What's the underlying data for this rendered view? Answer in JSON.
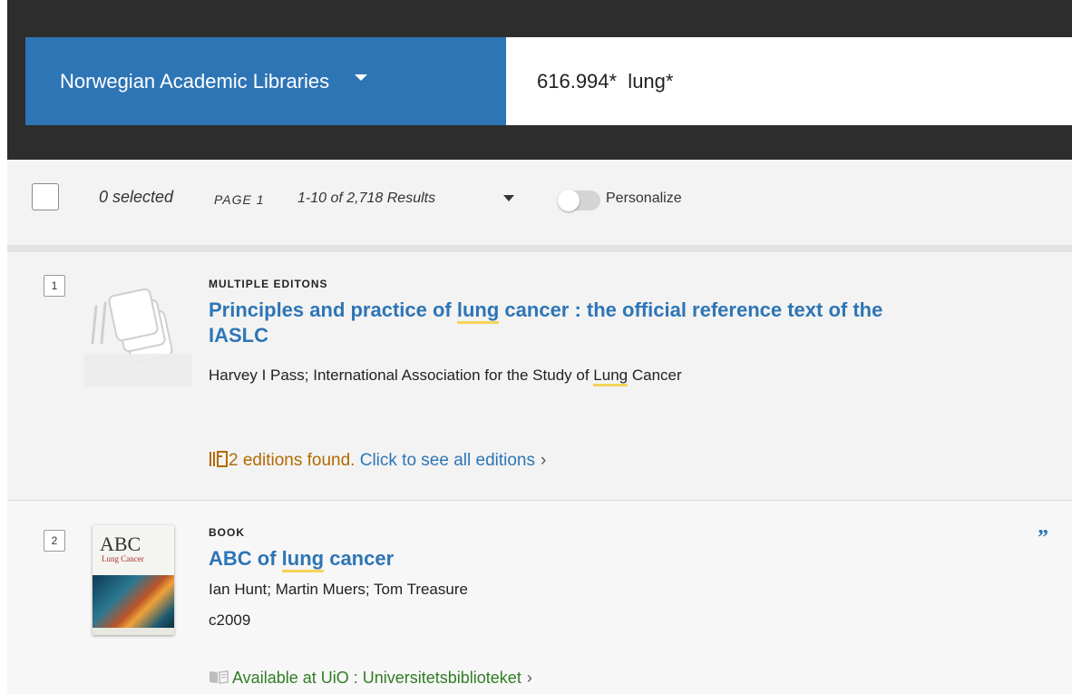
{
  "header": {
    "scope_label": "Norwegian Academic Libraries",
    "query": "616.994*  lung*"
  },
  "toolbar": {
    "selected": "0 selected",
    "page": "PAGE 1",
    "results": "1-10 of 2,718 Results",
    "personalize": "Personalize",
    "personalize_on": false
  },
  "results": [
    {
      "number": "1",
      "type": "MULTIPLE EDITONS",
      "title_before": "Principles and practice of ",
      "title_highlight": "lung",
      "title_after_line1": " cancer : the official reference text of the",
      "title_line2": "IASLC",
      "author_before": "Harvey I Pass; International Association for the Study of ",
      "author_highlight": "Lung",
      "author_after": " Cancer",
      "editions_icon": "editions-icon",
      "editions_found": "2 editions found.",
      "editions_link": "Click to see all editions",
      "thumbnail_icon": "multiple-editions-icon"
    },
    {
      "number": "2",
      "type": "BOOK",
      "title_before": "ABC of ",
      "title_highlight": "lung",
      "title_after": " cancer",
      "authors": "Ian Hunt; Martin Muers; Tom Treasure",
      "date": "c2009",
      "availability_icon": "book-open-icon",
      "availability": "Available at UiO : Universitetsbiblioteket",
      "thumb_title": "ABC",
      "thumb_sub": "Lung Cancer",
      "citation_icon": "quote-icon"
    }
  ],
  "colors": {
    "header_bg": "#2d2d2d",
    "scope_bg": "#2e75b6",
    "link": "#2e75b6",
    "highlight": "#f5d35a",
    "editions": "#b26a00",
    "available": "#2f7d23"
  }
}
